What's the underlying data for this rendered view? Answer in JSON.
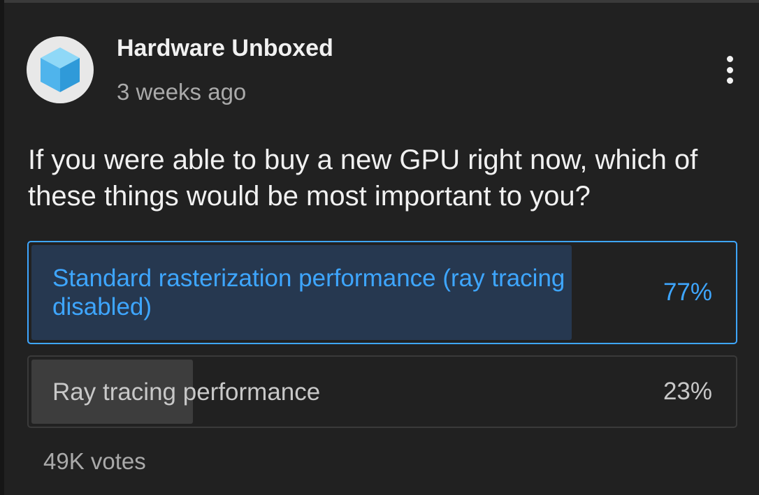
{
  "post": {
    "channel_name": "Hardware Unboxed",
    "timestamp": "3 weeks ago",
    "question": "If you were able to buy a new GPU right now, which of these things would be most important to you?",
    "avatar_icon": "blue-cube-icon",
    "menu_icon": "more-vertical-icon"
  },
  "poll": {
    "options": [
      {
        "label": "Standard rasterization performance (ray tracing disabled)",
        "percent_text": "77%",
        "percent": 77,
        "selected": true
      },
      {
        "label": "Ray tracing performance",
        "percent_text": "23%",
        "percent": 23,
        "selected": false
      }
    ],
    "vote_count": "49K votes"
  },
  "colors": {
    "background": "#212121",
    "accent": "#3ea6ff",
    "selected_fill": "#263850",
    "unselected_fill": "#3d3d3d",
    "secondary_text": "#aaaaaa"
  }
}
